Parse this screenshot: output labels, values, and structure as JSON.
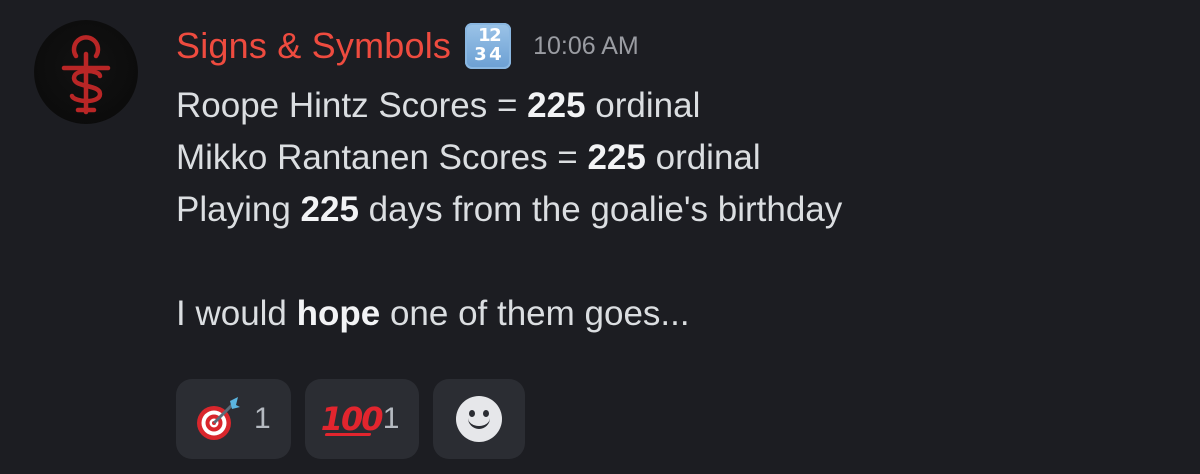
{
  "message": {
    "author": "Signs & Symbols",
    "author_color": "#ee4b3f",
    "badge": {
      "icon": "input-numbers-icon",
      "digits": [
        "1",
        "2",
        "3",
        "4"
      ]
    },
    "timestamp": "10:06 AM",
    "lines": [
      {
        "pre": "Roope Hintz Scores = ",
        "bold": "225",
        "post": " ordinal"
      },
      {
        "pre": "Mikko Rantanen Scores = ",
        "bold": "225",
        "post": " ordinal"
      },
      {
        "pre": "Playing ",
        "bold": "225",
        "post": " days from the goalie's birthday"
      },
      {
        "pre": "",
        "bold": "",
        "post": ""
      },
      {
        "pre": "I would ",
        "bold": "hope",
        "post": " one of them goes..."
      }
    ]
  },
  "reactions": [
    {
      "emoji": "direct-hit-icon",
      "count": "1"
    },
    {
      "emoji": "hundred-points-icon",
      "count": "1",
      "glyph": "100"
    },
    {
      "emoji": "add-reaction-icon"
    }
  ]
}
